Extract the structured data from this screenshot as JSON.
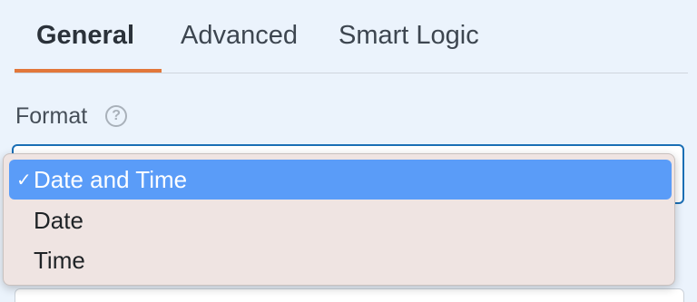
{
  "tabs": [
    {
      "label": "General",
      "active": true
    },
    {
      "label": "Advanced",
      "active": false
    },
    {
      "label": "Smart Logic",
      "active": false
    }
  ],
  "format": {
    "label": "Format",
    "help_icon": "question-circle-icon"
  },
  "dropdown": {
    "selected_check": "✓",
    "options": [
      {
        "label": "Date and Time",
        "selected": true
      },
      {
        "label": "Date",
        "selected": false
      },
      {
        "label": "Time",
        "selected": false
      }
    ]
  },
  "colors": {
    "accent_tab": "#e2773a",
    "select_border": "#1b6fb5",
    "selected_option_bg": "#5a9cf8",
    "page_bg": "#ebf3fc"
  }
}
